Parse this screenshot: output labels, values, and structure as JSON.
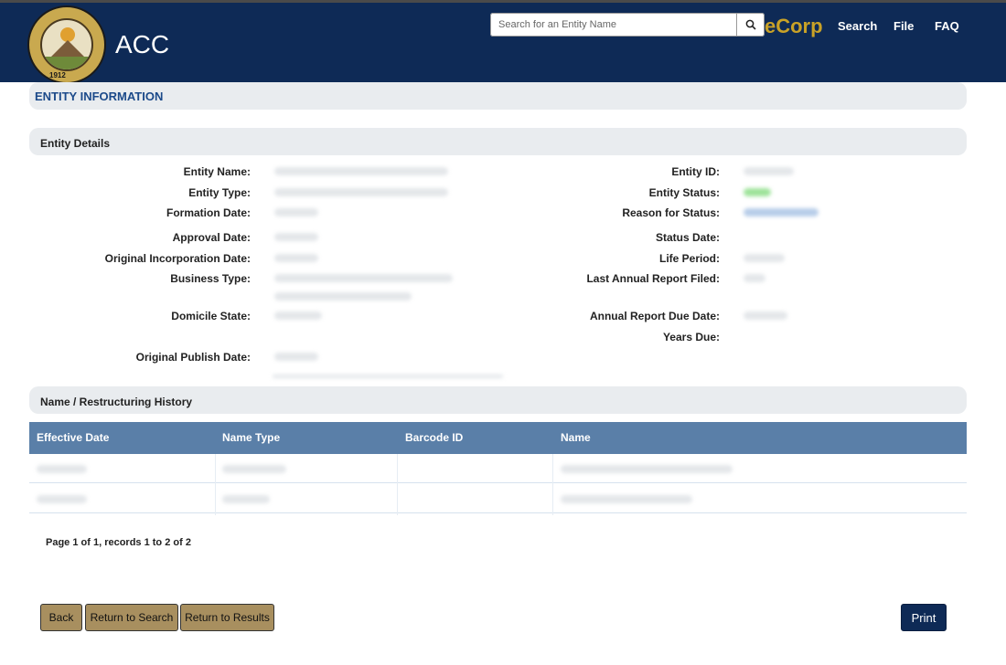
{
  "header": {
    "org_short": "ACC",
    "seal_year": "1912",
    "search_placeholder": "Search for an Entity Name",
    "brand": "eCorp",
    "nav": [
      "Search",
      "File",
      "FAQ"
    ]
  },
  "page_title": "ENTITY INFORMATION",
  "entity_details": {
    "section_title": "Entity Details",
    "left_labels": [
      "Entity Name:",
      "Entity Type:",
      "Formation Date:",
      "Approval Date:",
      "Original Incorporation Date:",
      "Business Type:",
      "Domicile State:",
      "Original Publish Date:"
    ],
    "right_labels": [
      "Entity ID:",
      "Entity Status:",
      "Reason for Status:",
      "Status Date:",
      "Life Period:",
      "Last Annual Report Filed:",
      "Annual Report Due Date:",
      "Years Due:"
    ]
  },
  "history": {
    "section_title": "Name / Restructuring History",
    "columns": [
      "Effective Date",
      "Name Type",
      "Barcode ID",
      "Name"
    ]
  },
  "pager": "Page 1 of 1, records 1 to 2 of 2",
  "buttons": {
    "back": "Back",
    "return_search": "Return to Search",
    "return_results": "Return to Results",
    "print": "Print"
  },
  "colors": {
    "header_bg": "#0e2a56",
    "brand": "#c9a227",
    "title_blue": "#1c4a8a",
    "table_header": "#5a7fa8",
    "button_tan": "#a88f5f"
  }
}
